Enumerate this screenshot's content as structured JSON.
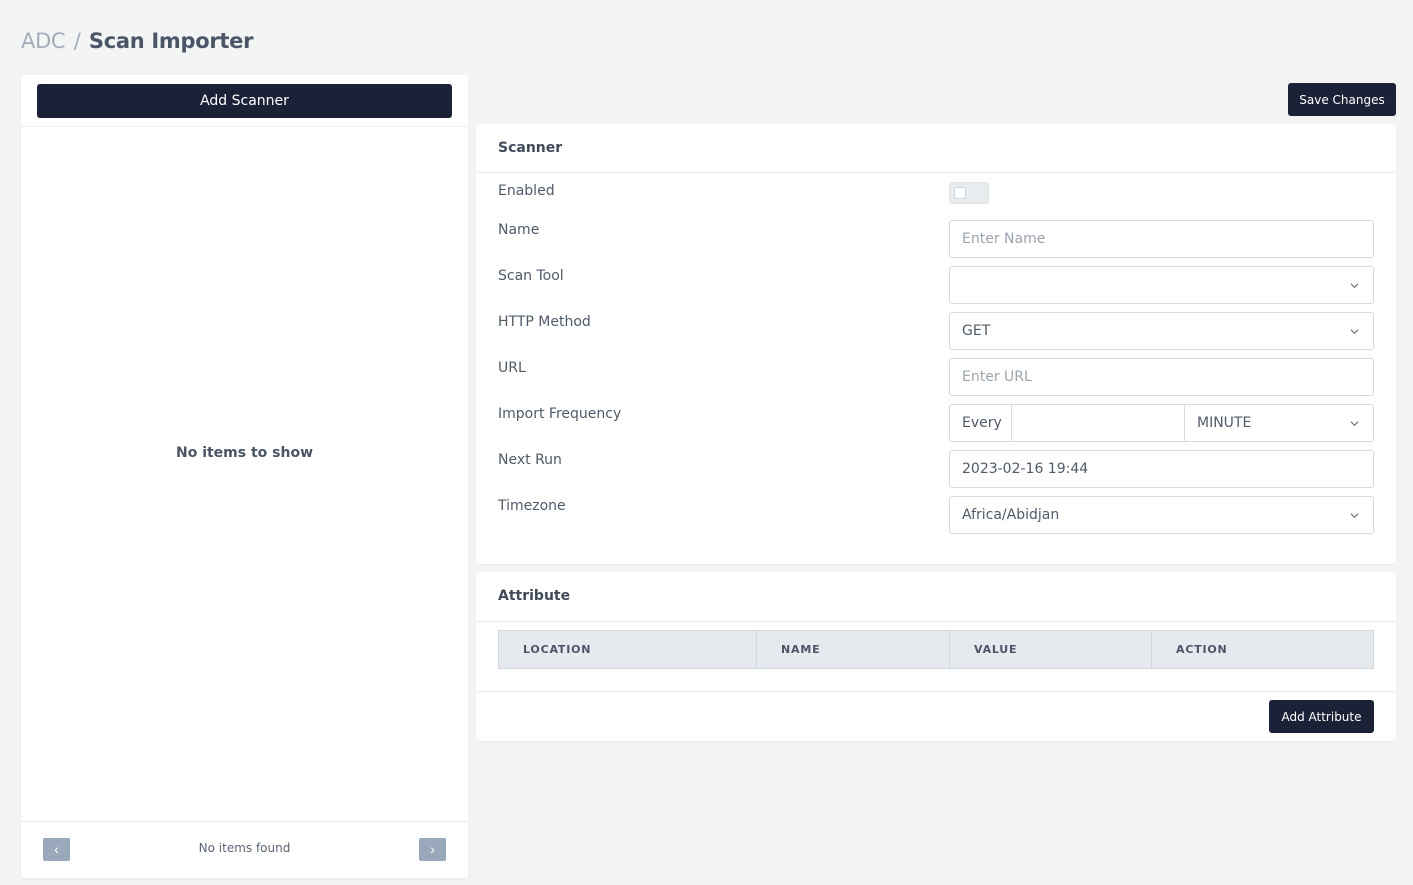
{
  "breadcrumb": {
    "root": "ADC",
    "separator": "/",
    "current": "Scan Importer"
  },
  "left_panel": {
    "add_button": "Add Scanner",
    "empty_message": "No items to show",
    "pager": {
      "prev_icon": "chevron-left-icon",
      "next_icon": "chevron-right-icon",
      "text": "No items found",
      "prev_glyph": "‹",
      "next_glyph": "›"
    }
  },
  "toolbar": {
    "save_label": "Save Changes"
  },
  "scanner": {
    "title": "Scanner",
    "fields": {
      "enabled": {
        "label": "Enabled",
        "value": false
      },
      "name": {
        "label": "Name",
        "placeholder": "Enter Name"
      },
      "scan_tool": {
        "label": "Scan Tool",
        "value": ""
      },
      "http_method": {
        "label": "HTTP Method",
        "value": "GET"
      },
      "url": {
        "label": "URL",
        "placeholder": "Enter URL"
      },
      "import_frequency": {
        "label": "Import Frequency",
        "prefix": "Every",
        "value": "",
        "unit": "MINUTE"
      },
      "next_run": {
        "label": "Next Run",
        "value": "2023-02-16 19:44"
      },
      "timezone": {
        "label": "Timezone",
        "value": "Africa/Abidjan"
      }
    }
  },
  "attribute": {
    "title": "Attribute",
    "columns": [
      "LOCATION",
      "NAME",
      "VALUE",
      "ACTION"
    ],
    "rows": [],
    "add_label": "Add Attribute"
  },
  "colors": {
    "primary": "#1b2238",
    "background": "#f3f4f4",
    "pager": "#9aa8bb"
  }
}
